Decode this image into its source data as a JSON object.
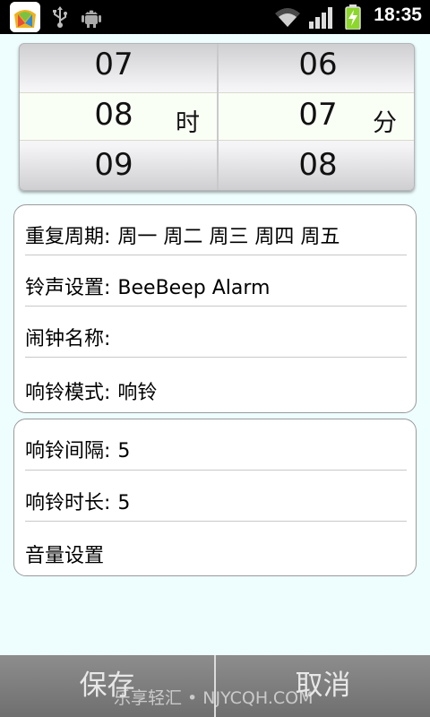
{
  "status_bar": {
    "time": "18:35"
  },
  "picker": {
    "hours": {
      "prev": "07",
      "current": "08",
      "next": "09",
      "unit": "时"
    },
    "minutes": {
      "prev": "06",
      "current": "07",
      "next": "08",
      "unit": "分"
    }
  },
  "group1": {
    "repeat": {
      "label": "重复周期:",
      "value": "周一 周二 周三 周四 周五"
    },
    "ringtone": {
      "label": "铃声设置:",
      "value": "BeeBeep Alarm"
    },
    "name": {
      "label": "闹钟名称:",
      "value": ""
    },
    "mode": {
      "label": "响铃模式:",
      "value": "响铃"
    }
  },
  "group2": {
    "interval": {
      "label": "响铃间隔:",
      "value": "5"
    },
    "duration": {
      "label": "响铃时长:",
      "value": "5"
    },
    "volume": {
      "label": "音量设置"
    }
  },
  "buttons": {
    "save": "保存",
    "cancel": "取消"
  },
  "watermark": "乐享轻汇 • NJYCQH.COM"
}
